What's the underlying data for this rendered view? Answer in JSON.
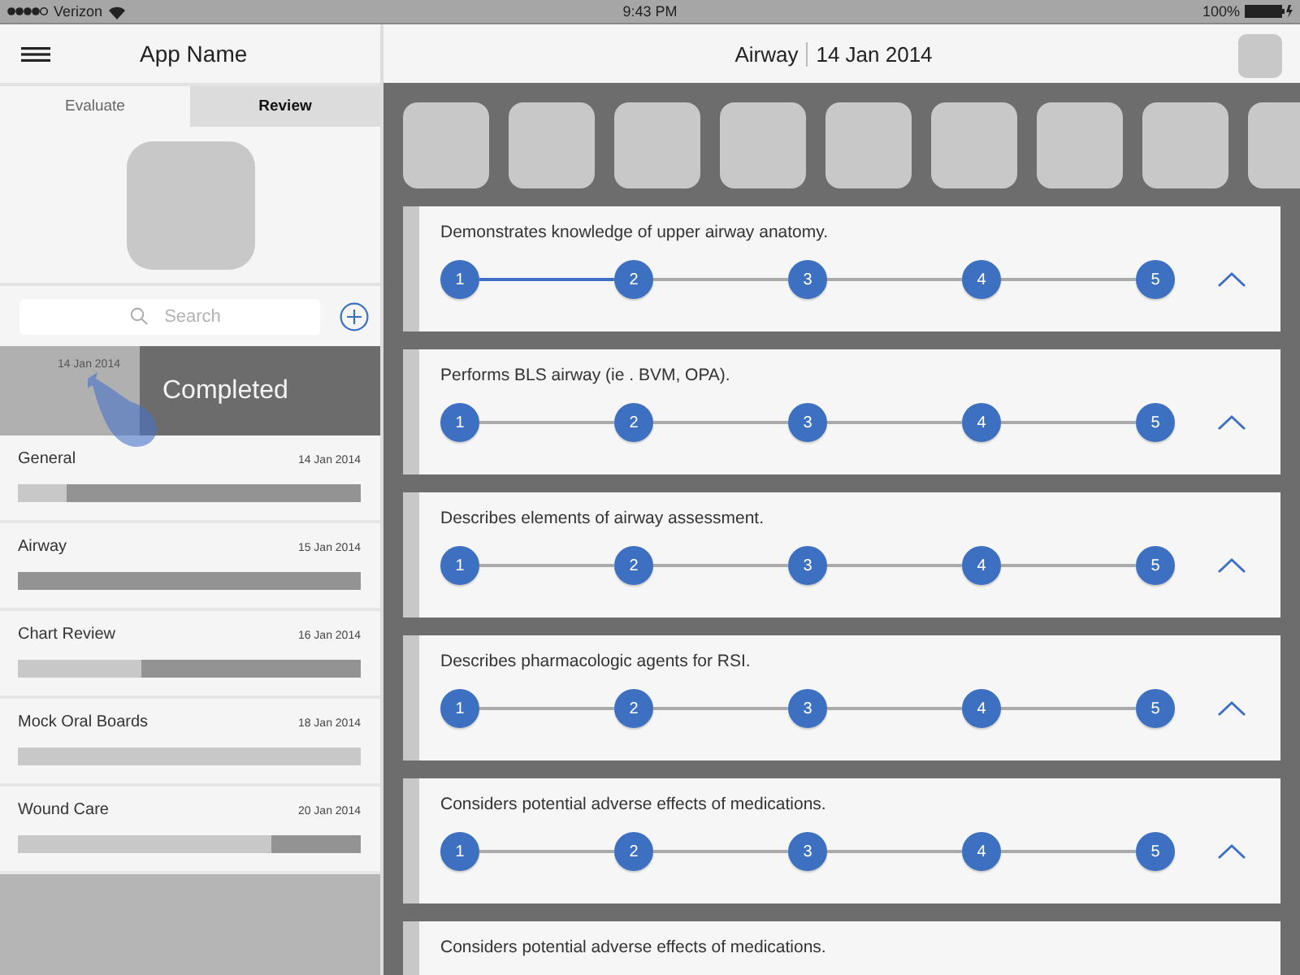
{
  "status_bar": {
    "carrier": "Verizon",
    "time": "9:43 PM",
    "battery": "100%"
  },
  "sidebar": {
    "app_name": "App Name",
    "tabs": [
      {
        "label": "Evaluate",
        "selected": false
      },
      {
        "label": "Review",
        "selected": true
      }
    ],
    "search": {
      "placeholder": "Search"
    },
    "swiped_item": {
      "date": "14 Jan 2014",
      "action": "Completed"
    },
    "items": [
      {
        "title": "General",
        "date": "14 Jan 2014",
        "level": 0.86
      },
      {
        "title": "Airway",
        "date": "15 Jan 2014",
        "level": 1
      },
      {
        "title": "Chart Review",
        "date": "16 Jan 2014",
        "level": 0.64
      },
      {
        "title": "Mock Oral Boards",
        "date": "18 Jan 2014",
        "level": 0
      },
      {
        "title": "Wound Care",
        "date": "20 Jan 2014",
        "level": 0.26
      }
    ]
  },
  "main": {
    "title": "Airway",
    "date": "14 Jan 2014",
    "criteria": [
      {
        "text": "Demonstrates knowledge of upper airway anatomy.",
        "steps": [
          "1",
          "2",
          "3",
          "4",
          "5"
        ],
        "connectors": [
          {
            "filled": true
          },
          {
            "filled": false
          },
          {
            "filled": false
          },
          {
            "filled": false
          }
        ]
      },
      {
        "text": "Performs BLS airway (ie . BVM, OPA).",
        "steps": [
          "1",
          "2",
          "3",
          "4",
          "5"
        ],
        "connectors": [
          {
            "filled": false
          },
          {
            "filled": false
          },
          {
            "filled": false
          },
          {
            "filled": false
          }
        ]
      },
      {
        "text": "Describes elements of airway assessment.",
        "steps": [
          "1",
          "2",
          "3",
          "4",
          "5"
        ],
        "connectors": [
          {
            "filled": false
          },
          {
            "filled": false
          },
          {
            "filled": false
          },
          {
            "filled": false
          }
        ]
      },
      {
        "text": "Describes pharmacologic agents for RSI.",
        "steps": [
          "1",
          "2",
          "3",
          "4",
          "5"
        ],
        "connectors": [
          {
            "filled": false
          },
          {
            "filled": false
          },
          {
            "filled": false
          },
          {
            "filled": false
          }
        ]
      },
      {
        "text": "Considers potential adverse effects of medications.",
        "steps": [
          "1",
          "2",
          "3",
          "4",
          "5"
        ],
        "connectors": [
          {
            "filled": false
          },
          {
            "filled": false
          },
          {
            "filled": false
          },
          {
            "filled": false
          }
        ]
      },
      {
        "text": "Considers potential adverse effects of medications."
      }
    ]
  }
}
